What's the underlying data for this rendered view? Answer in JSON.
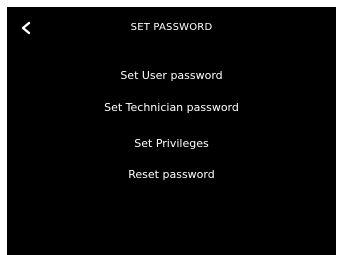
{
  "header": {
    "title": "SET PASSWORD",
    "back_icon": "chevron-left-icon"
  },
  "menu": {
    "items": [
      {
        "label": "Set User password"
      },
      {
        "label": "Set Technician password"
      },
      {
        "label": "Set Privileges"
      },
      {
        "label": "Reset password"
      }
    ]
  },
  "colors": {
    "background": "#000000",
    "text": "#ffffff"
  }
}
